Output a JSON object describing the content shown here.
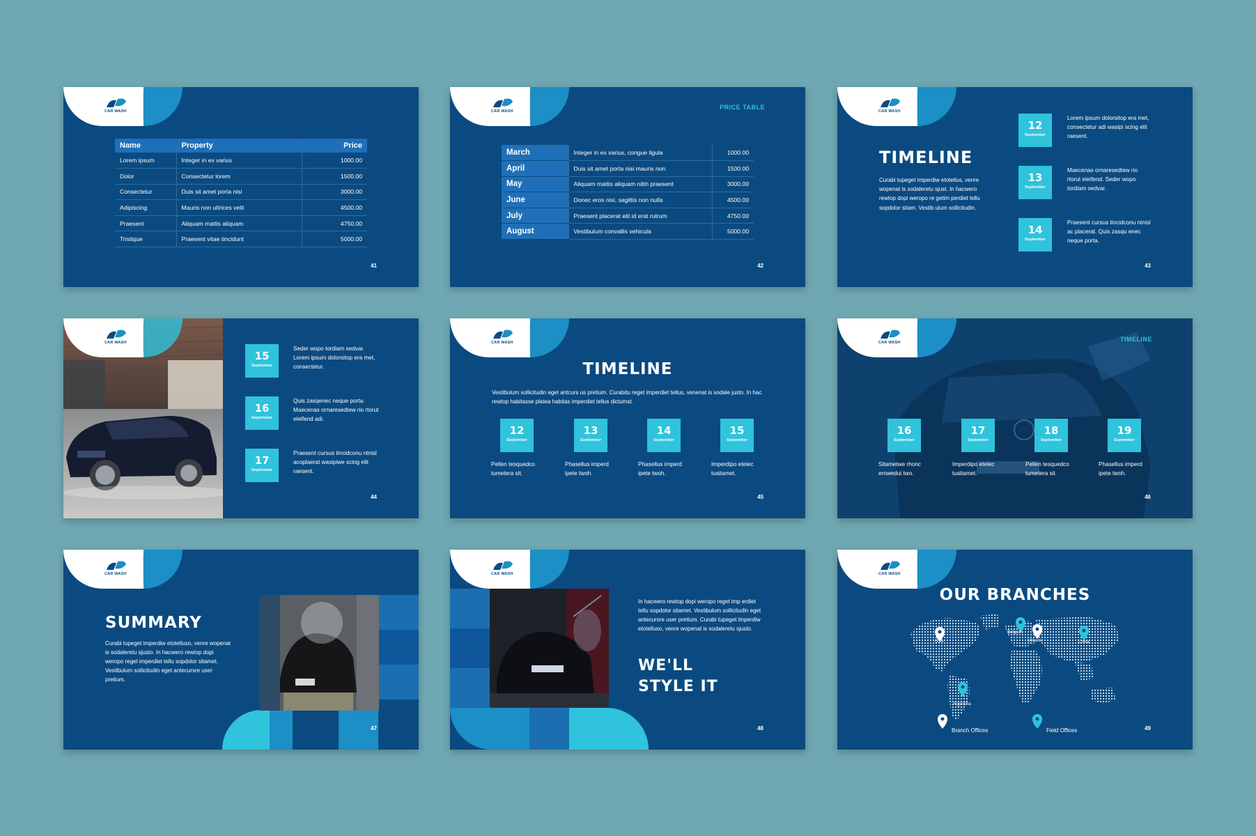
{
  "brand": {
    "logo_text": "CAR WASH",
    "colors": {
      "background": "#6fa7b2",
      "slide": "#0b4a80",
      "accent": "#2fc3dc",
      "mid_blue": "#1b8fc6"
    }
  },
  "slide41": {
    "page": "41",
    "headers": [
      "Name",
      "Property",
      "Price"
    ],
    "rows": [
      [
        "Lorem ipsum",
        "Integer in ex varius",
        "1000.00"
      ],
      [
        "Dolor",
        "Consectetur lorem",
        "1500.00"
      ],
      [
        "Consectetur",
        "Duis sit amet porta nisi",
        "3000.00"
      ],
      [
        "Adipiscing",
        "Mauris non ultrices velit",
        "4500.00"
      ],
      [
        "Praesent",
        "Aliquam mattis aliquam",
        "4750.00"
      ],
      [
        "Tristique",
        "Praesent vitae tincidunt",
        "5000.00"
      ]
    ]
  },
  "slide42": {
    "page": "42",
    "label": "PRICE TABLE",
    "rows": [
      [
        "March",
        "Integer in ex varius, congue ligula",
        "1000.00"
      ],
      [
        "April",
        "Duis sit amet porta nisi mauris non",
        "1500.00"
      ],
      [
        "May",
        "Aliquam mattis aliquam nibh praesent",
        "3000.00"
      ],
      [
        "June",
        "Donec eros nisi, sagittis non nulla",
        "4500.00"
      ],
      [
        "July",
        "Praesent placerat elit id erat rutrum",
        "4750.00"
      ],
      [
        "August",
        "Vestibulum convallis vehicula",
        "5000.00"
      ]
    ]
  },
  "slide43": {
    "page": "43",
    "title": "TIMELINE",
    "body": "Curabi tupeget imperdiw etotellus, venre wopenat is sodaleretu sjust. In hacwero rewtop dopi weropo re getim perdiet tellu sopdolor sitam. Vestib ulum sollicitudin.",
    "items": [
      {
        "day": "12",
        "month": "September",
        "text": "Lorem ipsum dolorsitop era met, consectetur adi wasipi scing elit raesent."
      },
      {
        "day": "13",
        "month": "September",
        "text": "Maecenas ornaresedtew rio rtorut eleifend. Seder wopo tordiam sedvar."
      },
      {
        "day": "14",
        "month": "September",
        "text": "Praesent cursus tincidconu ntnisl ac placerat. Quis zasqu enec neque porta."
      }
    ]
  },
  "slide44": {
    "page": "44",
    "items": [
      {
        "day": "15",
        "month": "September",
        "text": "Seder wopo tordiam sedvar. Lorem ipsum dolorsitop era met, consectetur."
      },
      {
        "day": "16",
        "month": "September",
        "text": "Quis zasqenec neque porta. Maecenas ornaresedtew rio rtorut eleifend adi."
      },
      {
        "day": "17",
        "month": "September",
        "text": "Praesent cursus tincidconu ntnisl acoplaerat wasipiwe scing elit raesent."
      }
    ]
  },
  "slide45": {
    "page": "45",
    "title": "TIMELINE",
    "body": "Vestibulum sollicitudin eget antcurs us pretium. Curabitu reget imperdiet tellus, venenat is sodale justo. In hac rewtop habitasse platea habitas imperdiet tellus  dictumst.",
    "items": [
      {
        "day": "12",
        "month": "September",
        "text": "Pellen tesquedco tumetera sit."
      },
      {
        "day": "13",
        "month": "September",
        "text": "Phasellus imperd ipete twoh."
      },
      {
        "day": "14",
        "month": "September",
        "text": "Phasellus imperd ipete twoh."
      },
      {
        "day": "15",
        "month": "September",
        "text": "Imperdipo etelec tusitamet."
      }
    ]
  },
  "slide46": {
    "page": "46",
    "label": "TIMELINE",
    "items": [
      {
        "day": "16",
        "month": "September",
        "text": "Sitametwe rhonc erowedui two."
      },
      {
        "day": "17",
        "month": "September",
        "text": "Imperdipo etelec tusitamet."
      },
      {
        "day": "18",
        "month": "September",
        "text": "Pellen tesquedco tumetera sit."
      },
      {
        "day": "19",
        "month": "September",
        "text": "Phasellus imperd ipete twoh."
      }
    ]
  },
  "slide47": {
    "page": "47",
    "title": "SUMMARY",
    "body": "Curabi tupeget imperdiw etotelluso, venre wopenat is sodaleretu sjusto. In hacwero rewtop dopi weropo reget imperdiet tellu sopdolor sitamet. Vestibulum sollicitudin eget antecursre user pretium."
  },
  "slide48": {
    "page": "48",
    "body": "In hacwero rewtop dopi weropo reget imp erdiet tellu sopdolor sitamet. Vestibulum sollicitudin eget antecursre user pretium. Curabi tupeget imperdiw etotelluso, venre wopenat is sodaleretu sjusto.",
    "title_line1": "WE'LL",
    "title_line2": "STYLE IT"
  },
  "slide49": {
    "page": "49",
    "title": "OUR BRANCHES",
    "places": [
      "USA",
      "Belgium",
      "Ukraine",
      "China",
      "Argentina"
    ],
    "legend_branch": "Branch Offices",
    "legend_field": "Field Offices"
  }
}
